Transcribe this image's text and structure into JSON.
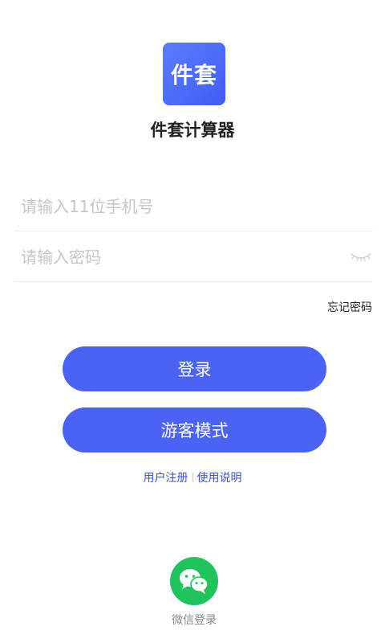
{
  "app": {
    "logo_text": "件套",
    "name": "件套计算器"
  },
  "login_form": {
    "phone_placeholder": "请输入11位手机号",
    "phone_value": "",
    "password_placeholder": "请输入密码",
    "password_value": "",
    "forgot_password": "忘记密码"
  },
  "actions": {
    "login_label": "登录",
    "guest_label": "游客模式"
  },
  "links": {
    "register": "用户注册",
    "help": "使用说明"
  },
  "social": {
    "wechat_label": "微信登录",
    "icon": "wechat-icon"
  },
  "colors": {
    "primary": "#4a63f3",
    "link": "#3d55c9",
    "wechat": "#1fc45c"
  }
}
